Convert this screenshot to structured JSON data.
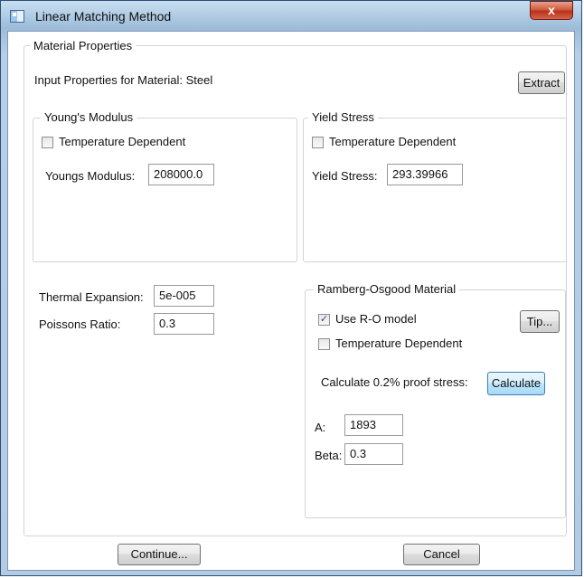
{
  "window": {
    "title": "Linear Matching Method",
    "close_label": "x"
  },
  "material": {
    "group_label": "Material Properties",
    "input_label": "Input Properties for Material: Steel",
    "extract_button": "Extract"
  },
  "youngs": {
    "group_label": "Young's Modulus",
    "temp_dependent_label": "Temperature Dependent",
    "temp_dependent_checked": false,
    "field_label": "Youngs Modulus:",
    "value": "208000.0"
  },
  "yield": {
    "group_label": "Yield Stress",
    "temp_dependent_label": "Temperature Dependent",
    "temp_dependent_checked": false,
    "field_label": "Yield Stress:",
    "value": "293.39966"
  },
  "thermal": {
    "label": "Thermal Expansion:",
    "value": "5e-005"
  },
  "poisson": {
    "label": "Poissons Ratio:",
    "value": "0.3"
  },
  "ramberg": {
    "group_label": "Ramberg-Osgood Material",
    "use_ro_label": "Use R-O model",
    "use_ro_checked": true,
    "check_mark": "✓",
    "tip_button": "Tip...",
    "temp_dependent_label": "Temperature Dependent",
    "temp_dependent_checked": false,
    "calc_label": "Calculate 0.2% proof stress:",
    "calc_button": "Calculate",
    "a_label": "A:",
    "a_value": "1893",
    "beta_label": "Beta:",
    "beta_value": "0.3"
  },
  "footer": {
    "continue_button": "Continue...",
    "cancel_button": "Cancel"
  }
}
